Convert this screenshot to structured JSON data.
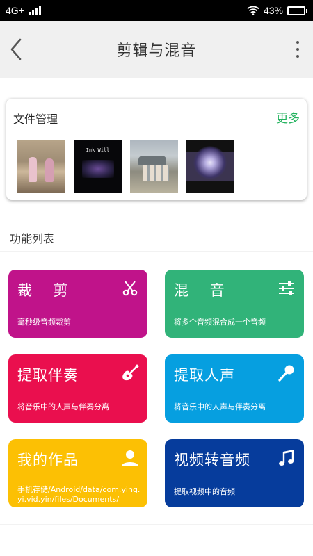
{
  "status_bar": {
    "network": "4G+",
    "battery": "43%",
    "battery_level": 0.43
  },
  "header": {
    "title": "剪辑与混音"
  },
  "file_manager": {
    "title": "文件管理",
    "more_label": "更多",
    "thumbnails": [
      {
        "name": "video-thumbnail-1"
      },
      {
        "name": "video-thumbnail-2",
        "caption": "Ink Will"
      },
      {
        "name": "video-thumbnail-3"
      },
      {
        "name": "video-thumbnail-4"
      }
    ]
  },
  "features": {
    "section_title": "功能列表",
    "tiles": [
      {
        "title": "裁 剪",
        "desc": "毫秒级音频裁剪",
        "color": "#c0138a",
        "icon": "scissors-icon"
      },
      {
        "title": "混 音",
        "desc": "将多个音频混合成一个音频",
        "color": "#31b379",
        "icon": "sliders-icon"
      },
      {
        "title": "提取伴奏",
        "desc": "将音乐中的人声与伴奏分离",
        "color": "#ea0f4e",
        "icon": "guitar-icon"
      },
      {
        "title": "提取人声",
        "desc": "将音乐中的人声与伴奏分离",
        "color": "#069fe0",
        "icon": "microphone-icon"
      },
      {
        "title": "我的作品",
        "desc": "手机存储/Android/data/com.ying.yi.vid.yin/files/Documents/",
        "color": "#fcc004",
        "icon": "person-icon"
      },
      {
        "title": "视频转音频",
        "desc": "提取视频中的音频",
        "color": "#063c9c",
        "icon": "music-note-icon"
      }
    ]
  }
}
